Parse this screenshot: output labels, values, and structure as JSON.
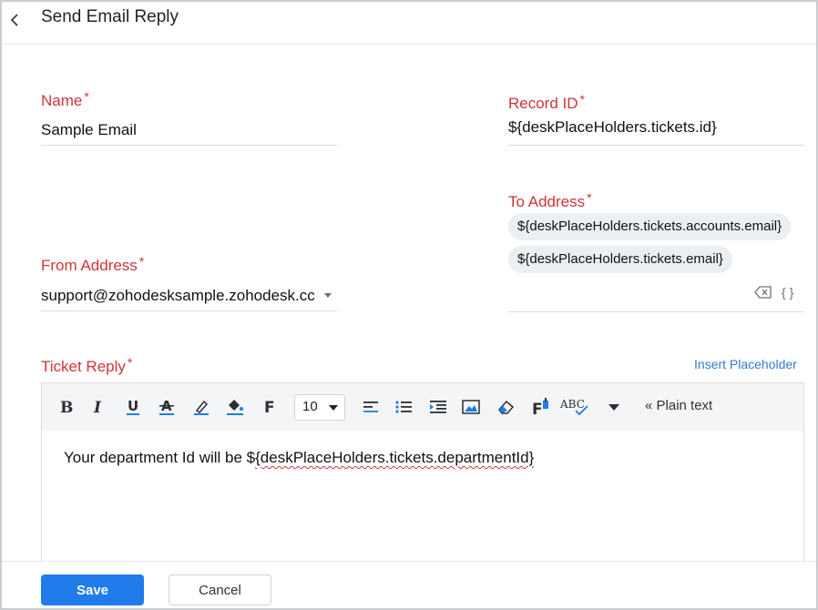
{
  "header": {
    "title": "Send Email Reply"
  },
  "form": {
    "name": {
      "label": "Name",
      "required": "*",
      "value": "Sample Email"
    },
    "record_id": {
      "label": "Record ID",
      "required": "*",
      "value": "${deskPlaceHolders.tickets.id}"
    },
    "to_address": {
      "label": "To Address",
      "required": "*",
      "chips": [
        "${deskPlaceHolders.tickets.accounts.email}",
        "${deskPlaceHolders.tickets.email}"
      ],
      "braces": "{ }"
    },
    "from_address": {
      "label": "From Address",
      "required": "*",
      "value": "support@zohodesksample.zohodesk.cc"
    },
    "ticket_reply": {
      "label": "Ticket Reply",
      "required": "*",
      "insert_placeholder": "Insert Placeholder",
      "body_prefix": "Your department Id will be $",
      "body_placeholder": "{deskPlaceHolders.tickets.departmentId}"
    }
  },
  "toolbar": {
    "icons": [
      "bold-icon",
      "italic-icon",
      "underline-icon",
      "strikethrough-icon",
      "text-color-icon",
      "background-color-icon",
      "font-family-icon",
      "align-left-icon",
      "bulleted-list-icon",
      "indent-icon",
      "insert-image-icon",
      "eraser-icon",
      "format-painter-icon",
      "spellcheck-icon",
      "more-icon"
    ],
    "font_size": "10",
    "plain_text": "« Plain text"
  },
  "footer": {
    "save_label": "Save",
    "cancel_label": "Cancel"
  },
  "colors": {
    "accent": "#1f7cea",
    "required_label": "#d13438",
    "link": "#2f7bd6",
    "chip_bg": "#eceff2"
  }
}
